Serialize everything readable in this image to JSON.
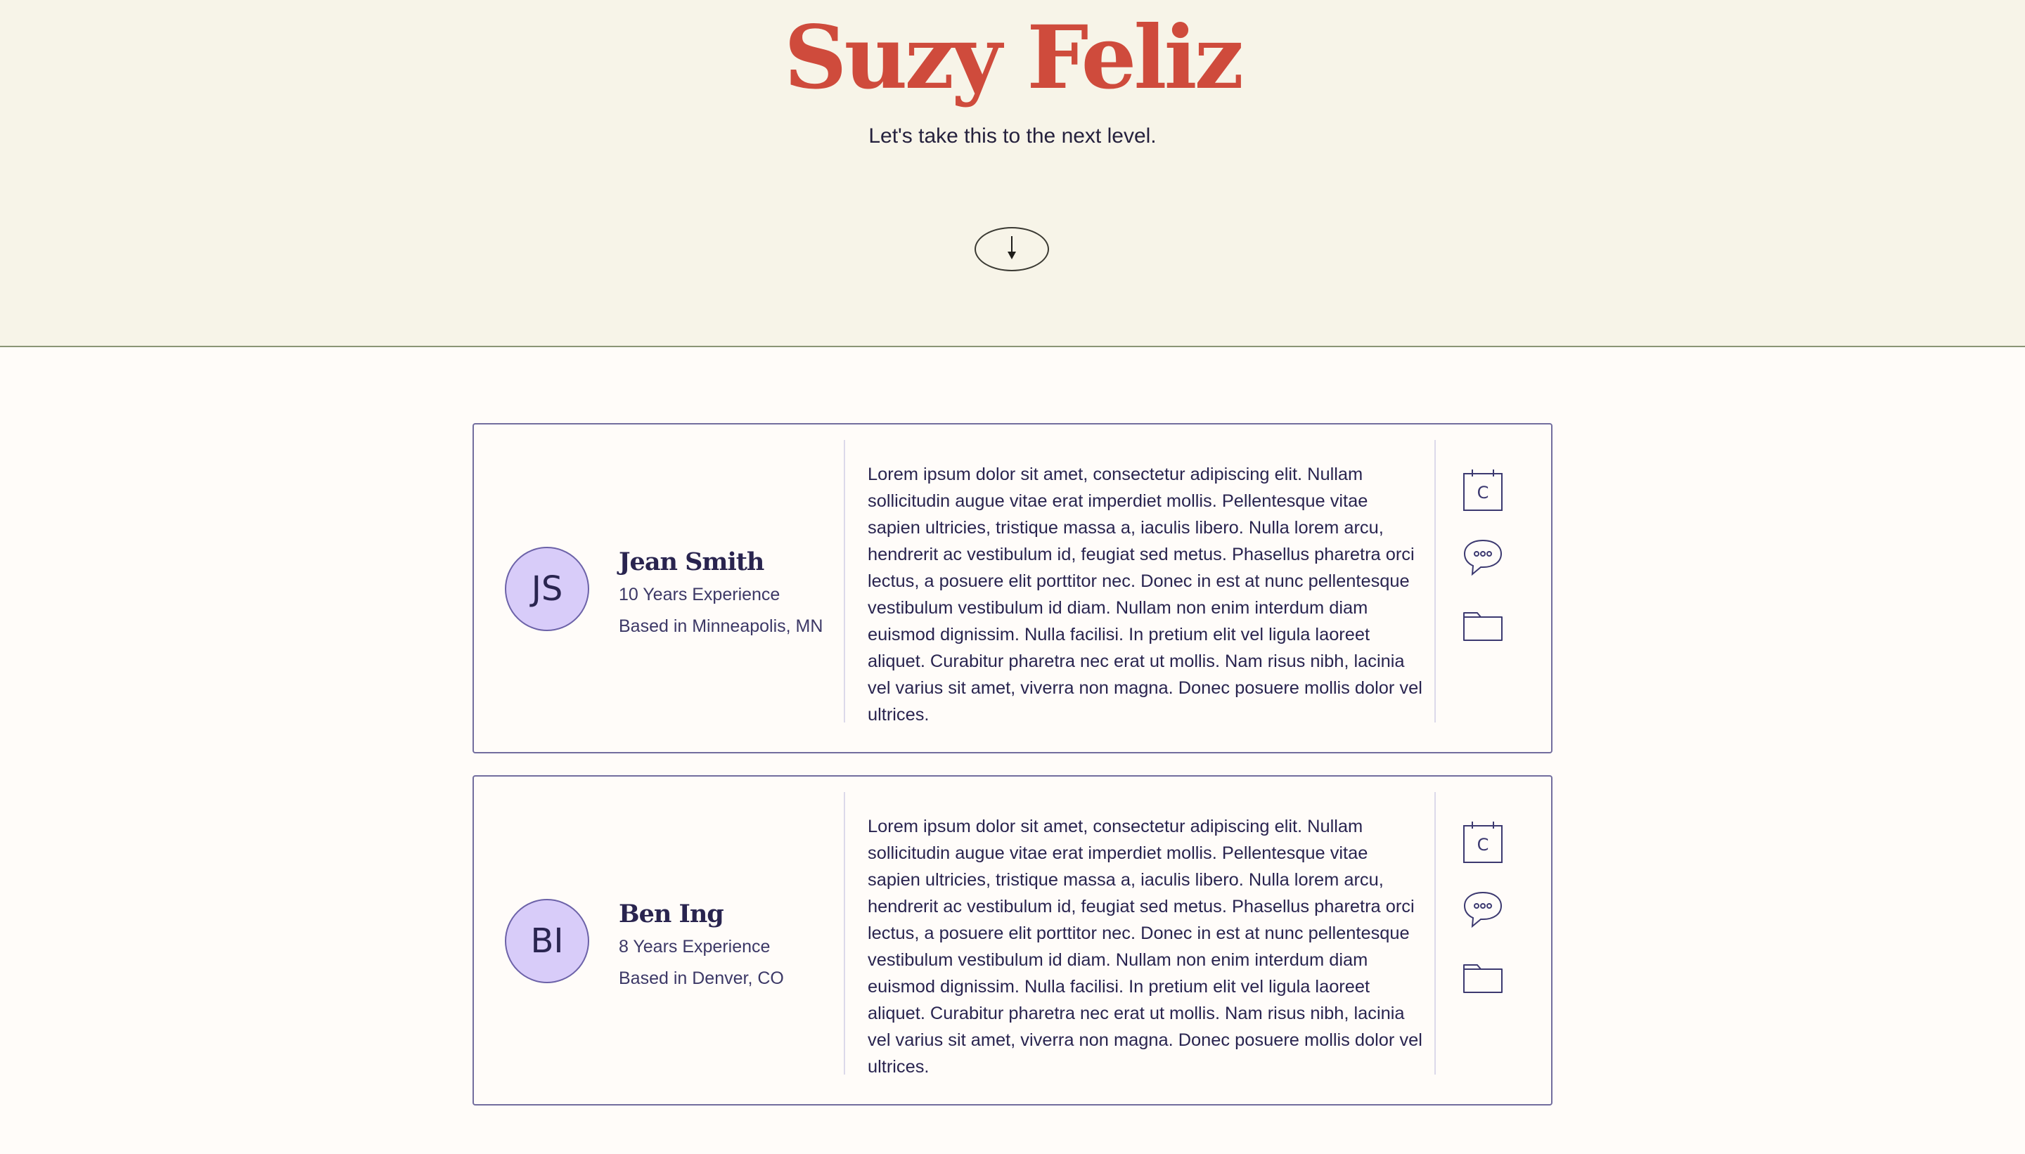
{
  "hero": {
    "title": "Suzy Feliz",
    "subtitle": "Let's take this to the next level.",
    "scroll_icon": "arrow-down-icon"
  },
  "colors": {
    "hero_background": "#f7f4e8",
    "title": "#cf4b3c",
    "accent": "#726d9e",
    "avatar_background": "#d8ccf9",
    "page_background": "#fffcf9"
  },
  "people": [
    {
      "initials": "JS",
      "name": "Jean Smith",
      "experience": "10 Years Experience",
      "location": "Based in Minneapolis, MN",
      "bio": "Lorem ipsum dolor sit amet, consectetur adipiscing elit. Nullam sollicitudin augue vitae erat imperdiet mollis. Pellentesque vitae sapien ultricies, tristique massa a, iaculis libero. Nulla lorem arcu, hendrerit ac vestibulum id, feugiat sed metus. Phasellus pharetra orci lectus, a posuere elit porttitor nec. Donec in est at nunc pellentesque vestibulum vestibulum id diam. Nullam non enim interdum diam euismod dignissim. Nulla facilisi. In pretium elit vel ligula laoreet aliquet. Curabitur pharetra nec erat ut mollis. Nam risus nibh, lacinia vel varius sit amet, viverra non magna. Donec posuere mollis dolor vel ultrices.",
      "actions": {
        "calendar_icon": "calendar-icon",
        "calendar_letter": "C",
        "chat_icon": "chat-bubble-icon",
        "folder_icon": "folder-icon"
      }
    },
    {
      "initials": "BI",
      "name": "Ben Ing",
      "experience": "8 Years Experience",
      "location": "Based in Denver, CO",
      "bio": "Lorem ipsum dolor sit amet, consectetur adipiscing elit. Nullam sollicitudin augue vitae erat imperdiet mollis. Pellentesque vitae sapien ultricies, tristique massa a, iaculis libero. Nulla lorem arcu, hendrerit ac vestibulum id, feugiat sed metus. Phasellus pharetra orci lectus, a posuere elit porttitor nec. Donec in est at nunc pellentesque vestibulum vestibulum id diam. Nullam non enim interdum diam euismod dignissim. Nulla facilisi. In pretium elit vel ligula laoreet aliquet. Curabitur pharetra nec erat ut mollis. Nam risus nibh, lacinia vel varius sit amet, viverra non magna. Donec posuere mollis dolor vel ultrices.",
      "actions": {
        "calendar_icon": "calendar-icon",
        "calendar_letter": "C",
        "chat_icon": "chat-bubble-icon",
        "folder_icon": "folder-icon"
      }
    }
  ]
}
